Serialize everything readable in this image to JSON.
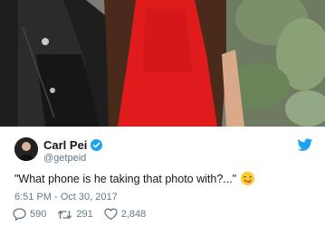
{
  "photo": {
    "icon": "photo-woman-red-dress-leather-jacket"
  },
  "tweet": {
    "author_name": "Carl Pei",
    "author_handle": "@getpeid",
    "text": "\"What phone is he taking that photo with?...\"",
    "timestamp": "6:51 PM - Oct 30, 2017",
    "verified_icon": "verified-badge-icon",
    "platform_icon": "twitter-bird-icon",
    "emoji_icon": "face-savoring-food-emoji"
  },
  "actions": {
    "reply_count": "590",
    "retweet_count": "291",
    "like_count": "2,848"
  },
  "colors": {
    "brand_blue": "#1da1f2",
    "muted_text": "#657786",
    "dress_red": "#e01b1b"
  }
}
